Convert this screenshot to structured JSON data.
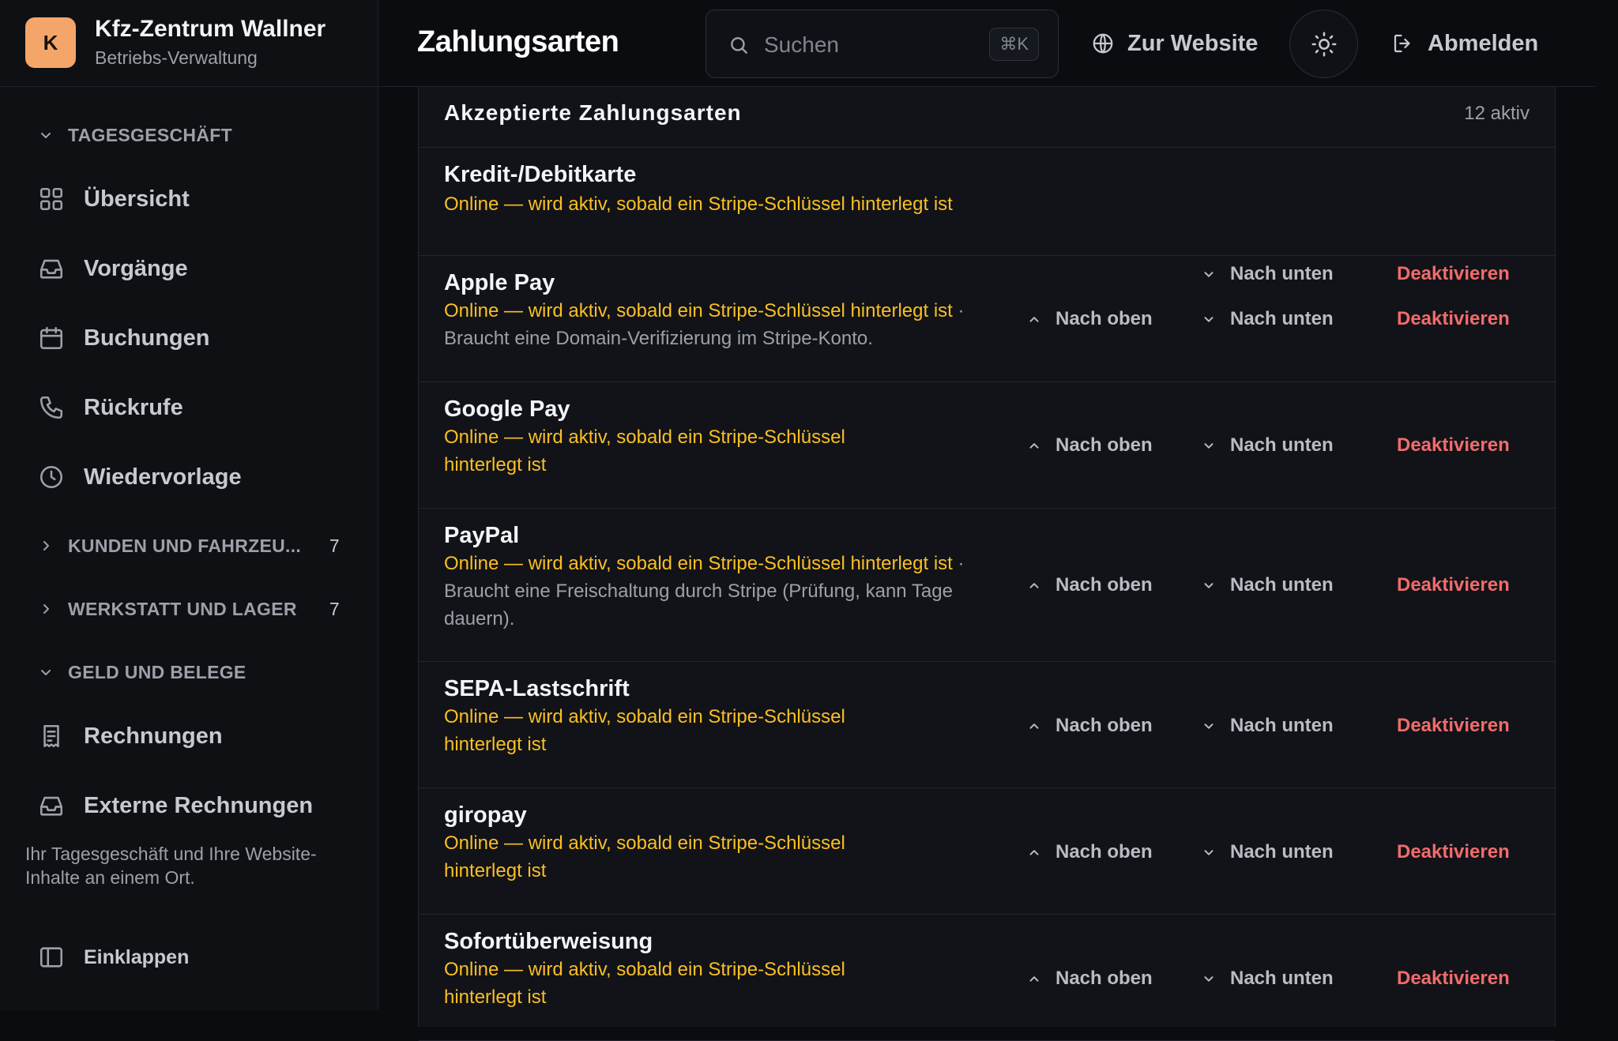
{
  "brand": {
    "logo_letter": "K",
    "name": "Kfz-Zentrum Wallner",
    "subtitle": "Betriebs-Verwaltung",
    "accent": "#f4a66a"
  },
  "sidebar": {
    "sections": [
      {
        "label": "TAGESGESCHÄFT",
        "expanded": true,
        "count": ""
      },
      {
        "label": "KUNDEN UND FAHRZEU...",
        "expanded": false,
        "count": "7"
      },
      {
        "label": "WERKSTATT UND LAGER",
        "expanded": false,
        "count": "7"
      },
      {
        "label": "GELD UND BELEGE",
        "expanded": true,
        "count": ""
      }
    ],
    "items": [
      {
        "label": "Übersicht",
        "icon": "grid-icon"
      },
      {
        "label": "Vorgänge",
        "icon": "inbox-icon"
      },
      {
        "label": "Buchungen",
        "icon": "calendar-icon"
      },
      {
        "label": "Rückrufe",
        "icon": "phone-icon"
      },
      {
        "label": "Wiedervorlage",
        "icon": "clock-icon"
      },
      {
        "label": "Rechnungen",
        "icon": "receipt-icon"
      },
      {
        "label": "Externe Rechnungen",
        "icon": "inbox-icon"
      }
    ],
    "hint": "Ihr Tagesgeschäft und Ihre Website-Inhalte an einem Ort.",
    "collapse_label": "Einklappen"
  },
  "topbar": {
    "title": "Zahlungsarten",
    "search_placeholder": "Suchen",
    "search_shortcut": "⌘K",
    "website_label": "Zur Website",
    "logout_label": "Abmelden"
  },
  "card": {
    "title": "Akzeptierte Zahlungsarten",
    "count": "12 aktiv",
    "actions": {
      "up": "Nach oben",
      "down": "Nach unten",
      "deactivate": "Deaktivieren"
    },
    "methods": [
      {
        "name": "Kredit-/Debitkarte",
        "status": "Online — wird aktiv, sobald ein Stripe-Schlüssel hinterlegt ist",
        "note": ""
      },
      {
        "name": "Apple Pay",
        "status": "Online — wird aktiv, sobald ein Stripe-Schlüssel hinterlegt ist",
        "note": " · Braucht eine Domain-Verifizierung im Stripe-Konto."
      },
      {
        "name": "Google Pay",
        "status": "Online — wird aktiv, sobald ein Stripe-Schlüssel hinterlegt ist",
        "note": ""
      },
      {
        "name": "PayPal",
        "status": "Online — wird aktiv, sobald ein Stripe-Schlüssel hinterlegt ist",
        "note": " · Braucht eine Freischaltung durch Stripe (Prüfung, kann Tage dauern)."
      },
      {
        "name": "SEPA-Lastschrift",
        "status": "Online — wird aktiv, sobald ein Stripe-Schlüssel hinterlegt ist",
        "note": ""
      },
      {
        "name": "giropay",
        "status": "Online — wird aktiv, sobald ein Stripe-Schlüssel hinterlegt ist",
        "note": ""
      },
      {
        "name": "Sofortüberweisung",
        "status": "Online — wird aktiv, sobald ein Stripe-Schlüssel hinterlegt ist",
        "note": ""
      }
    ]
  }
}
